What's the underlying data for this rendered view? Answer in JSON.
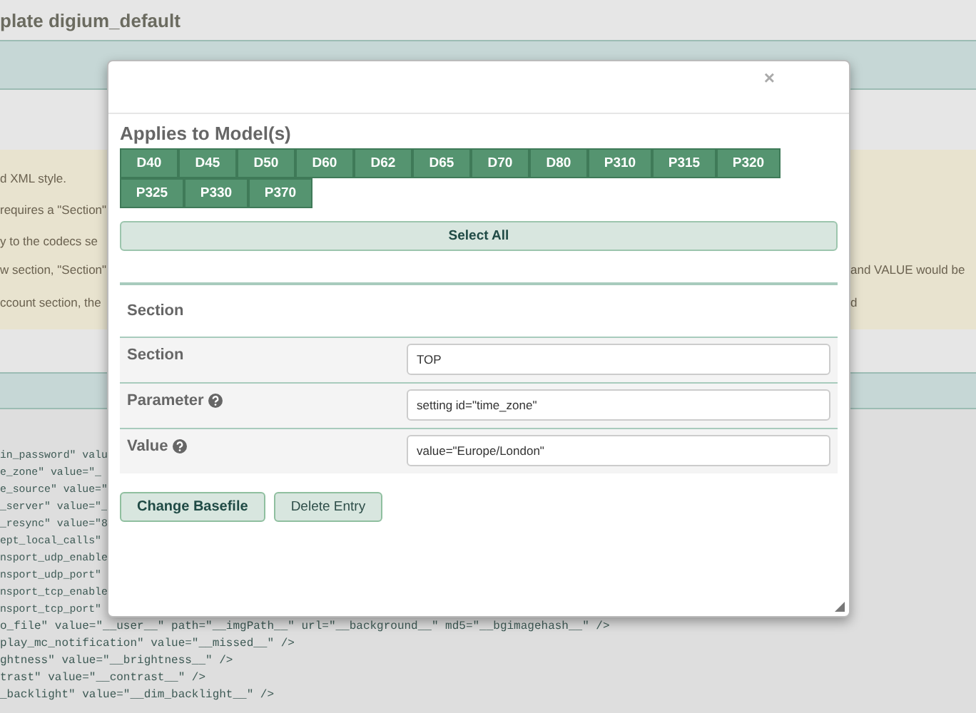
{
  "page": {
    "title": "plate digium_default",
    "notes": [
      {
        "left": "d XML style."
      },
      {
        "left": "requires a \"Section\""
      },
      {
        "left": "y to the codecs se"
      },
      {
        "left": "w section, \"Section\"",
        "right": "and VALUE would be"
      },
      {
        "left": "ccount section, the",
        "right": "d"
      }
    ],
    "code_left": [
      "in_password\" valu",
      "e_zone\" value=\"_",
      "e_source\" value=\"",
      "_server\" value=\"_",
      "_resync\" value=\"8",
      "ept_local_calls\"",
      "nsport_udp_enable",
      "nsport_udp_port\"",
      "nsport_tcp_enable",
      "nsport_tcp_port\""
    ],
    "code_full": [
      "o_file\" value=\"__user__\" path=\"__imgPath__\" url=\"__background__\" md5=\"__bgimagehash__\" />",
      "play_mc_notification\" value=\"__missed__\" />",
      "ghtness\" value=\"__brightness__\" />",
      "trast\" value=\"__contrast__\" />",
      "_backlight\" value=\"__dim_backlight__\" />"
    ]
  },
  "modal": {
    "close": "×",
    "heading": "Applies to Model(s)",
    "models": [
      "D40",
      "D45",
      "D50",
      "D60",
      "D62",
      "D65",
      "D70",
      "D80",
      "P310",
      "P315",
      "P320",
      "P325",
      "P330",
      "P370"
    ],
    "select_all": "Select All",
    "section_heading": "Section",
    "fields": [
      {
        "label": "Section",
        "help": false,
        "value": "TOP"
      },
      {
        "label": "Parameter",
        "help": true,
        "value": "setting id=\"time_zone\""
      },
      {
        "label": "Value",
        "help": true,
        "value": "value=\"Europe/London\""
      }
    ],
    "buttons": [
      {
        "label": "Change Basefile",
        "kind": "primary"
      },
      {
        "label": "Delete Entry",
        "kind": "secondary"
      }
    ]
  }
}
